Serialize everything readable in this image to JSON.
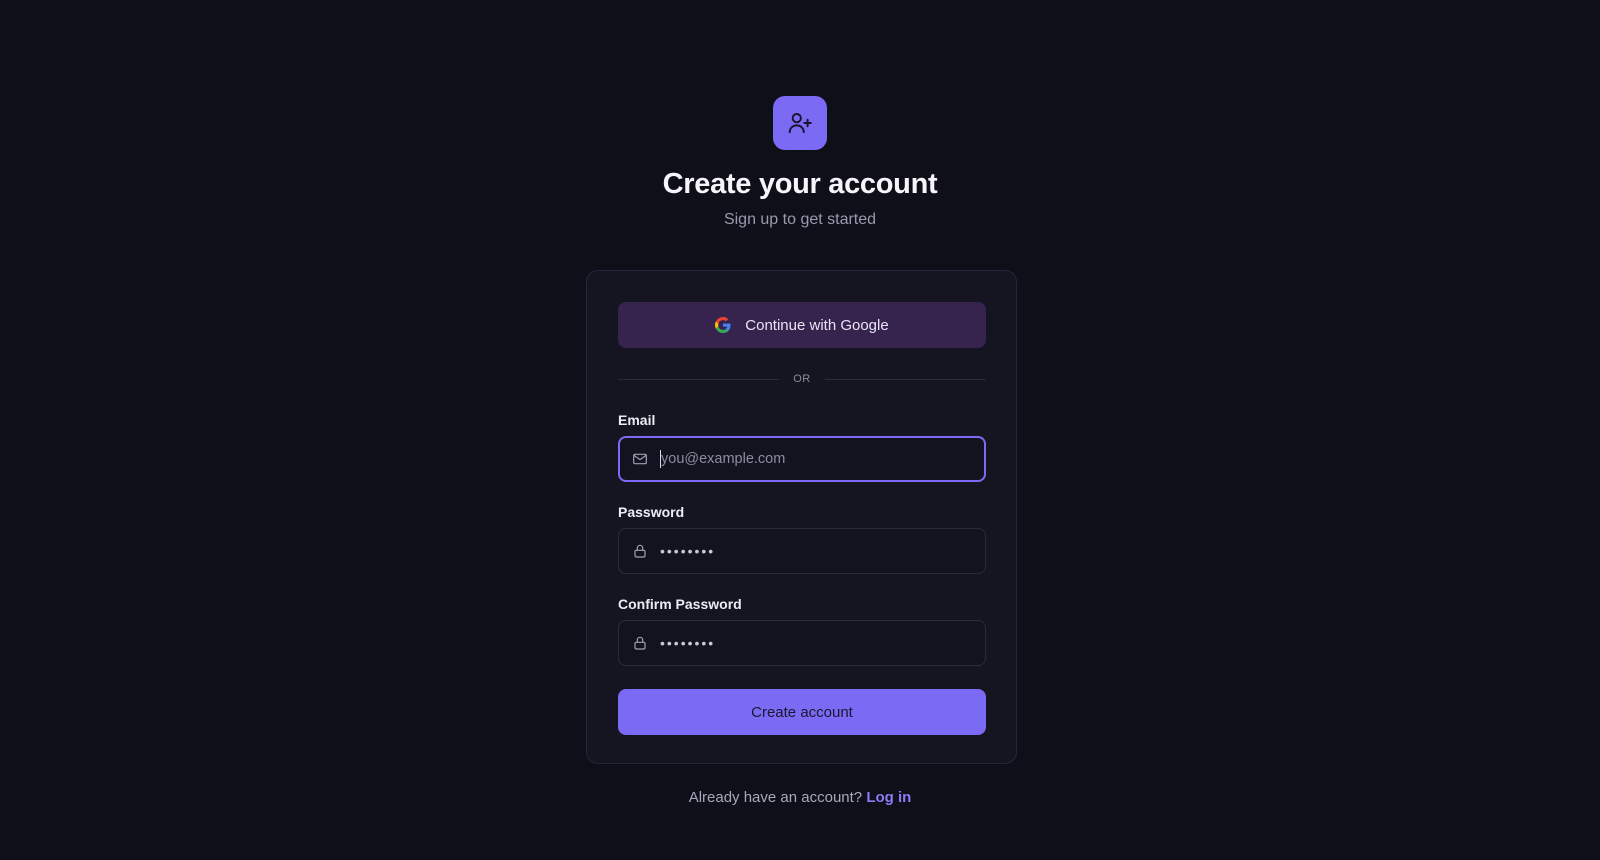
{
  "header": {
    "logo_icon": "user-plus-icon",
    "title": "Create your account",
    "subtitle": "Sign up to get started"
  },
  "form": {
    "google_button": {
      "label": "Continue with Google",
      "icon": "google-icon"
    },
    "divider_text": "OR",
    "email": {
      "label": "Email",
      "placeholder": "you@example.com",
      "value": "",
      "icon": "mail-icon"
    },
    "password": {
      "label": "Password",
      "value": "••••••••",
      "icon": "lock-icon"
    },
    "confirm_password": {
      "label": "Confirm Password",
      "value": "••••••••",
      "icon": "lock-icon"
    },
    "submit_label": "Create account"
  },
  "footer": {
    "prompt": "Already have an account?",
    "link": "Log in"
  },
  "colors": {
    "background": "#0f0f1a",
    "card": "#151522",
    "accent": "#7b6af3",
    "google_button_bg": "#36244f",
    "link": "#8b7af8"
  }
}
